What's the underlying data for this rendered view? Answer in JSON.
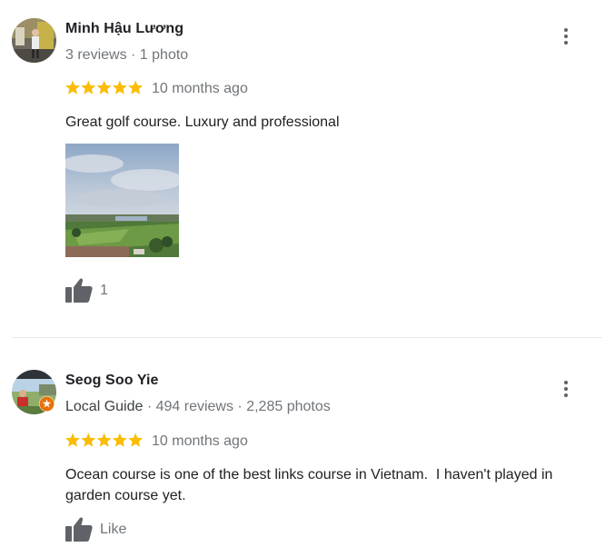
{
  "colors": {
    "star": "#fbbc04",
    "secondary_text": "#70757a",
    "primary_text": "#202124",
    "icon": "#5f6368",
    "divider": "#e8eaed",
    "local_guide_badge": "#e8710a"
  },
  "reviews": [
    {
      "author": "Minh Hậu Lương",
      "meta": "3 reviews · 1 photo",
      "rating": 5,
      "date": "10 months ago",
      "text": "Great golf course. Luxury and professional",
      "like_label": "1",
      "icons": [
        "avatar",
        "more-vert-icon",
        "star-icon",
        "thumbs-up-icon"
      ]
    },
    {
      "author": "Seog Soo Yie",
      "local_guide": "Local Guide",
      "meta": " · 494 reviews · 2,285 photos",
      "rating": 5,
      "date": "10 months ago",
      "text": "Ocean course is one of the best links course in Vietnam.  I haven't played in garden course yet.",
      "like_label": "Like",
      "icons": [
        "avatar",
        "local-guide-badge-icon",
        "more-vert-icon",
        "star-icon",
        "thumbs-up-icon"
      ]
    }
  ]
}
